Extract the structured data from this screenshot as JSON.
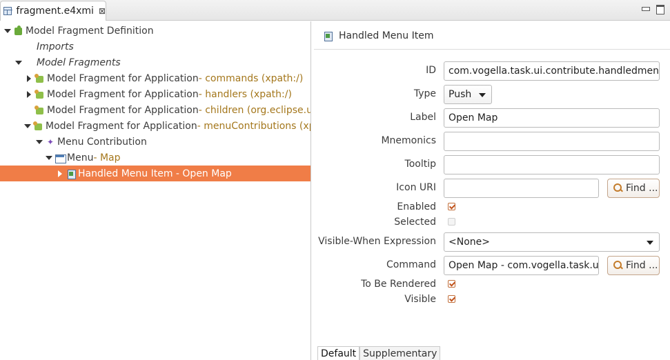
{
  "tab": {
    "title": "fragment.e4xmi",
    "close": "⊠"
  },
  "tree": [
    {
      "label": "Model Fragment Definition",
      "sub": ""
    },
    {
      "label": "Imports",
      "sub": ""
    },
    {
      "label": "Model Fragments",
      "sub": ""
    },
    {
      "label": "Model Fragment for Application",
      "sub": " - commands (xpath:/)"
    },
    {
      "label": "Model Fragment for Application",
      "sub": " - handlers (xpath:/)"
    },
    {
      "label": "Model Fragment for Application",
      "sub": " - children (org.eclipse.ui."
    },
    {
      "label": "Model Fragment for Application",
      "sub": " - menuContributions (xpa"
    },
    {
      "label": "Menu Contribution",
      "sub": ""
    },
    {
      "label": "Menu",
      "sub": " - Map"
    },
    {
      "label": "Handled Menu Item - Open Map",
      "sub": ""
    }
  ],
  "details": {
    "title": "Handled Menu Item",
    "id_label": "ID",
    "id_value": "com.vogella.task.ui.contribute.handledmenu",
    "type_label": "Type",
    "type_value": "Push",
    "label_label": "Label",
    "label_value": "Open Map",
    "mnemonics_label": "Mnemonics",
    "mnemonics_value": "",
    "tooltip_label": "Tooltip",
    "tooltip_value": "",
    "icon_label": "Icon URI",
    "icon_value": "",
    "find_label": "Find ...",
    "enabled_label": "Enabled",
    "selected_label": "Selected",
    "visible_when_label": "Visible-When Expression",
    "visible_when_value": "<None>",
    "command_label": "Command",
    "command_value": "Open Map - com.vogella.task.ui.",
    "to_be_rendered_label": "To Be Rendered",
    "visible_label": "Visible",
    "checkboxes": {
      "enabled": true,
      "selected": false,
      "to_be_rendered": true,
      "visible": true
    }
  },
  "bottom_tabs": [
    "Default",
    "Supplementary"
  ]
}
